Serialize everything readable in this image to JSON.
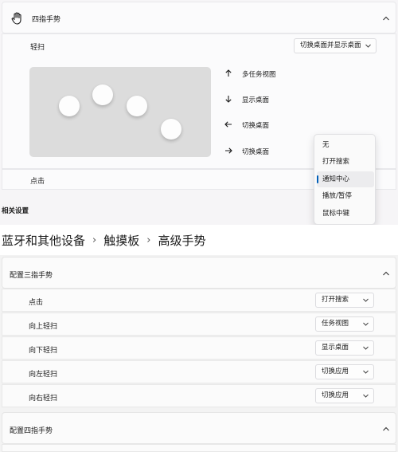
{
  "four_finger": {
    "title": "四指手势",
    "swipe_label": "轻扫",
    "swipe_value": "切换桌面并显示桌面",
    "gestures": [
      {
        "arrow": "up",
        "label": "多任务视图"
      },
      {
        "arrow": "down",
        "label": "显示桌面"
      },
      {
        "arrow": "left",
        "label": "切换桌面"
      },
      {
        "arrow": "right",
        "label": "切换桌面"
      }
    ],
    "tap_label": "点击",
    "tap_menu": [
      "无",
      "打开搜索",
      "通知中心",
      "播放/暂停",
      "鼠标中键"
    ],
    "tap_menu_selected": "通知中心"
  },
  "related_settings": "相关设置",
  "breadcrumb": [
    "蓝牙和其他设备",
    "触摸板",
    "高级手势"
  ],
  "three_finger": {
    "title": "配置三指手势",
    "rows": [
      {
        "label": "点击",
        "value": "打开搜索"
      },
      {
        "label": "向上轻扫",
        "value": "任务视图"
      },
      {
        "label": "向下轻扫",
        "value": "显示桌面"
      },
      {
        "label": "向左轻扫",
        "value": "切换应用"
      },
      {
        "label": "向右轻扫",
        "value": "切换应用"
      }
    ]
  },
  "four_finger_config": {
    "title": "配置四指手势"
  },
  "colors": {
    "accent": "#005fb8"
  }
}
